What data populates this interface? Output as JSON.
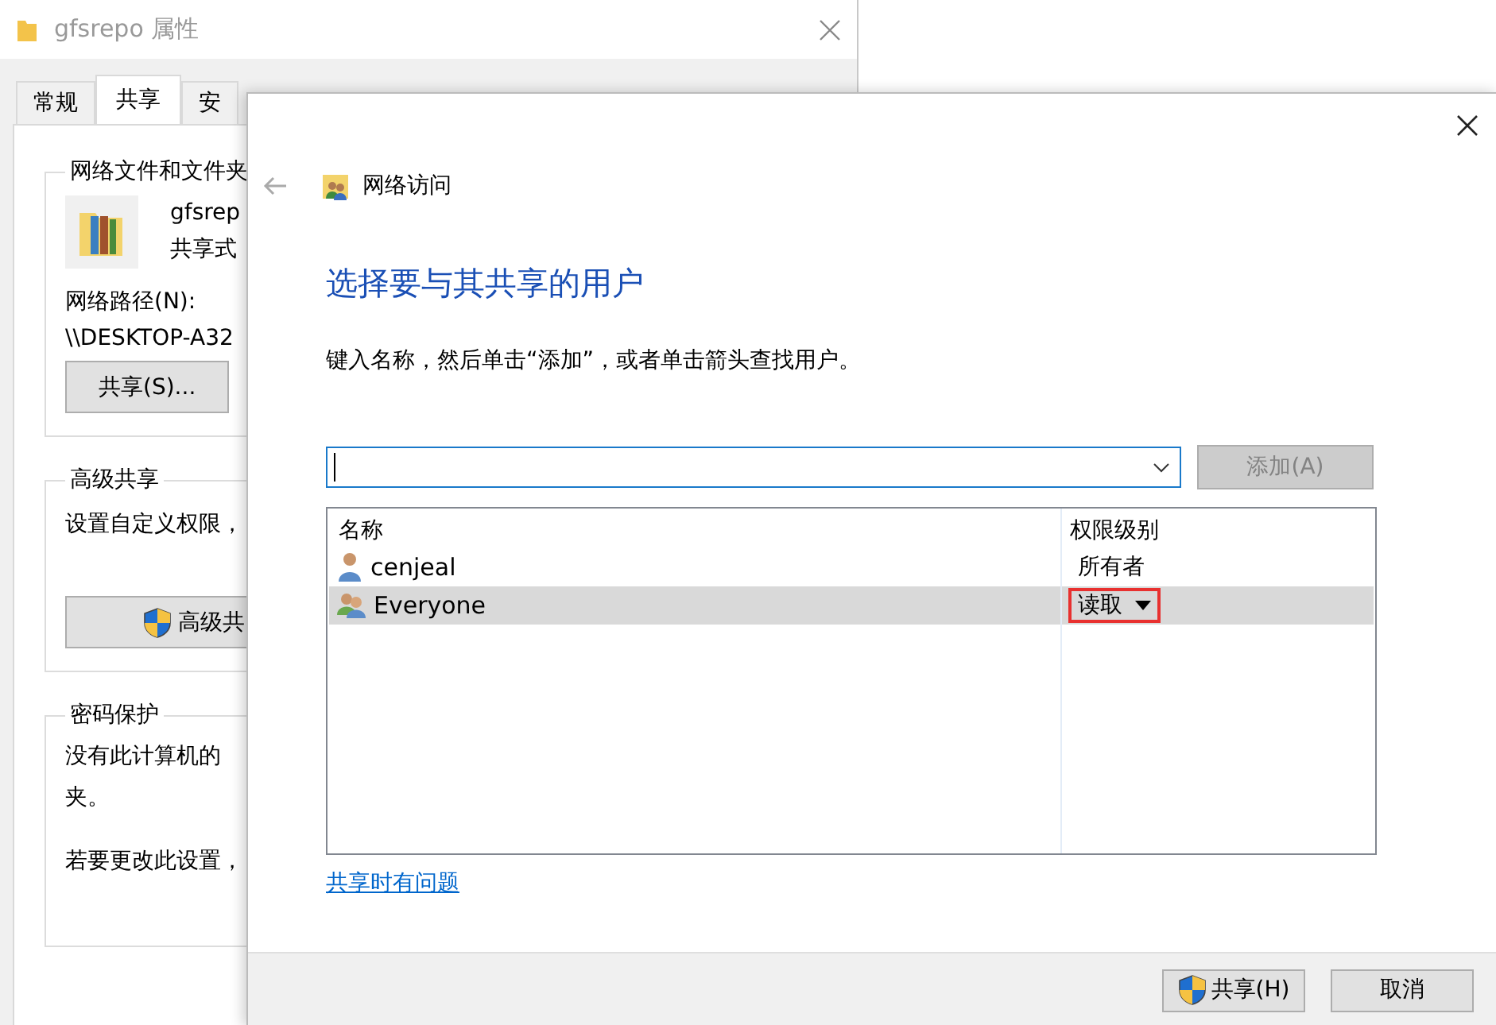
{
  "back_window": {
    "title": "gfsrepo 属性",
    "tabs": [
      {
        "label": "常规",
        "selected": false
      },
      {
        "label": "共享",
        "selected": true
      },
      {
        "label": "安",
        "selected": false
      }
    ],
    "groups": [
      {
        "title": "网络文件和文件夹",
        "folder_name": "gfsrep",
        "folder_status": "共享式",
        "path_label": "网络路径(N):",
        "path": "\\\\DESKTOP-A32",
        "button": "共享(S)..."
      },
      {
        "title": "高级共享",
        "text": "设置自定义权限，",
        "button": "高级共"
      },
      {
        "title": "密码保护",
        "lines": [
          "没有此计算机的",
          "夹。"
        ],
        "text2": "若要更改此设置，"
      }
    ]
  },
  "dialog": {
    "title": "网络访问",
    "heading": "选择要与其共享的用户",
    "instruction": "键入名称，然后单击“添加”，或者单击箭头查找用户。",
    "add_button": {
      "label": "添加(A)",
      "disabled": true
    },
    "table": {
      "columns": [
        "名称",
        "权限级别"
      ],
      "rows": [
        {
          "name": "cenjeal",
          "kind": "user",
          "permission": "所有者",
          "dropdown": false,
          "selected": false,
          "highlighted": false
        },
        {
          "name": "Everyone",
          "kind": "group",
          "permission": "读取",
          "dropdown": true,
          "selected": true,
          "highlighted": true
        }
      ]
    },
    "link": "共享时有问题",
    "buttons": [
      {
        "label": "共享(H)",
        "kind": "shield"
      },
      {
        "label": "取消",
        "kind": "plain"
      }
    ]
  }
}
